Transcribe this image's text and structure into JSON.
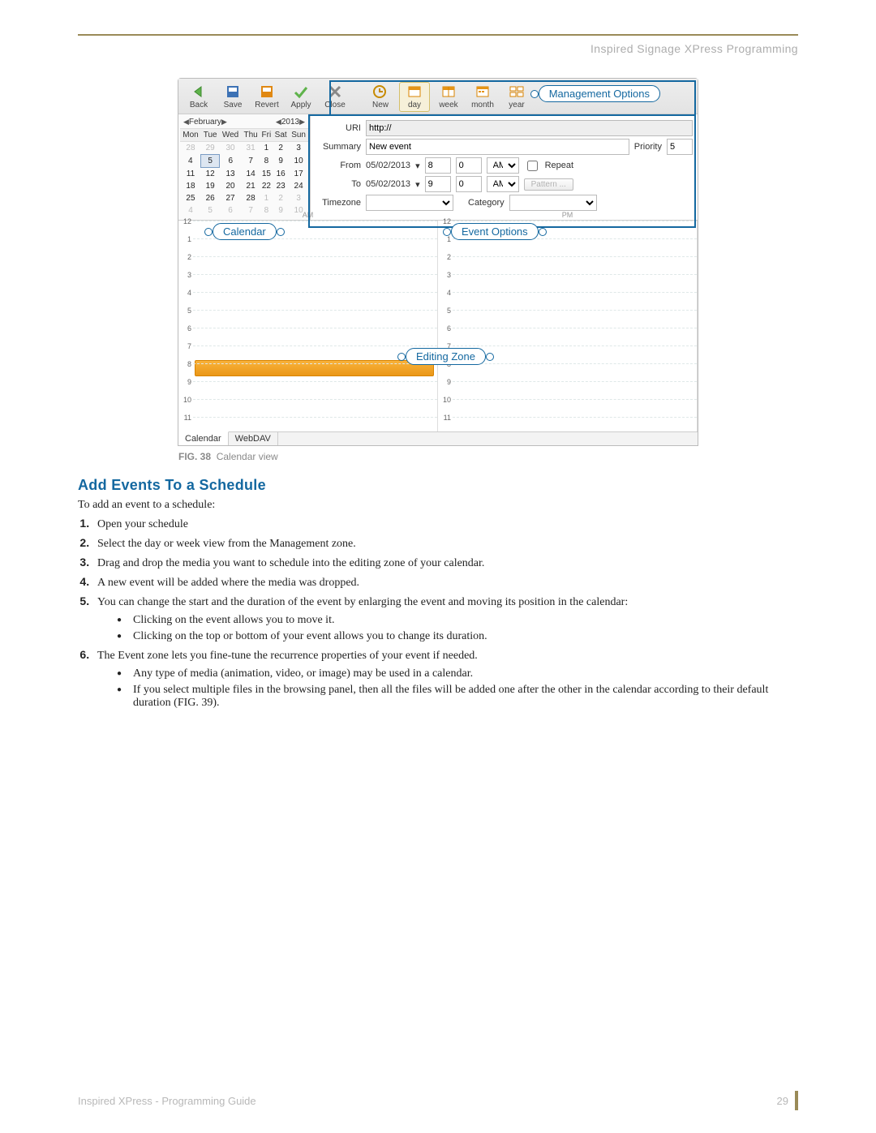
{
  "header": {
    "running": "Inspired Signage XPress Programming"
  },
  "toolbar": {
    "back": "Back",
    "save": "Save",
    "revert": "Revert",
    "apply": "Apply",
    "close": "Close",
    "new": "New",
    "day": "day",
    "week": "week",
    "month": "month",
    "year": "year"
  },
  "callouts": {
    "management": "Management Options",
    "calendar": "Calendar",
    "event": "Event Options",
    "editing": "Editing Zone"
  },
  "calendar": {
    "month": "February",
    "year": "2013",
    "days_header": [
      "Mon",
      "Tue",
      "Wed",
      "Thu",
      "Fri",
      "Sat",
      "Sun"
    ],
    "rows": [
      [
        "28",
        "29",
        "30",
        "31",
        "1",
        "2",
        "3"
      ],
      [
        "4",
        "5",
        "6",
        "7",
        "8",
        "9",
        "10"
      ],
      [
        "11",
        "12",
        "13",
        "14",
        "15",
        "16",
        "17"
      ],
      [
        "18",
        "19",
        "20",
        "21",
        "22",
        "23",
        "24"
      ],
      [
        "25",
        "26",
        "27",
        "28",
        "1",
        "2",
        "3"
      ],
      [
        "4",
        "5",
        "6",
        "7",
        "8",
        "9",
        "10"
      ]
    ],
    "other_month_cells": [
      [
        0,
        0
      ],
      [
        0,
        1
      ],
      [
        0,
        2
      ],
      [
        0,
        3
      ],
      [
        4,
        4
      ],
      [
        4,
        5
      ],
      [
        4,
        6
      ],
      [
        5,
        0
      ],
      [
        5,
        1
      ],
      [
        5,
        2
      ],
      [
        5,
        3
      ],
      [
        5,
        4
      ],
      [
        5,
        5
      ],
      [
        5,
        6
      ]
    ],
    "selected_cell": [
      1,
      1
    ]
  },
  "form": {
    "uri_label": "URI",
    "uri_value": "http://",
    "summary_label": "Summary",
    "summary_value": "New event",
    "priority_label": "Priority",
    "priority_value": "5",
    "from_label": "From",
    "from_date": "05/02/2013",
    "from_h": "8",
    "from_m": "0",
    "from_ampm": "AM",
    "repeat_label": "Repeat",
    "to_label": "To",
    "to_date": "05/02/2013",
    "to_h": "9",
    "to_m": "0",
    "to_ampm": "AM",
    "pattern_label": "Pattern ...",
    "tz_label": "Timezone",
    "cat_label": "Category"
  },
  "timeline": {
    "am": "AM",
    "pm": "PM",
    "hours": [
      "12",
      "1",
      "2",
      "3",
      "4",
      "5",
      "6",
      "7",
      "8",
      "9",
      "10",
      "11"
    ]
  },
  "bottom_tabs": {
    "calendar": "Calendar",
    "webdav": "WebDAV"
  },
  "caption": {
    "fig": "FIG. 38",
    "text": "Calendar view"
  },
  "section_title": "Add Events To a Schedule",
  "intro": "To add an event to a schedule:",
  "steps": [
    "Open your schedule",
    "Select the day or week view from the Management zone.",
    "Drag and drop the media you want to schedule into the editing zone of your calendar.",
    "A new event will be added where the media was dropped.",
    "You can change the start and the duration of the event by enlarging the event and moving its position in the calendar:",
    "The Event zone lets you fine-tune the recurrence properties of your event if needed."
  ],
  "sub5": [
    "Clicking on the event allows you to move it.",
    "Clicking on the top or bottom of your event allows you to change its duration."
  ],
  "sub6": [
    "Any type of media (animation, video, or image) may be used in a calendar.",
    "If you select multiple files in the browsing panel, then all the files will be added one after the other in the calendar according to their default duration (FIG. 39)."
  ],
  "footer": {
    "guide": "Inspired XPress - Programming Guide",
    "page": "29"
  }
}
